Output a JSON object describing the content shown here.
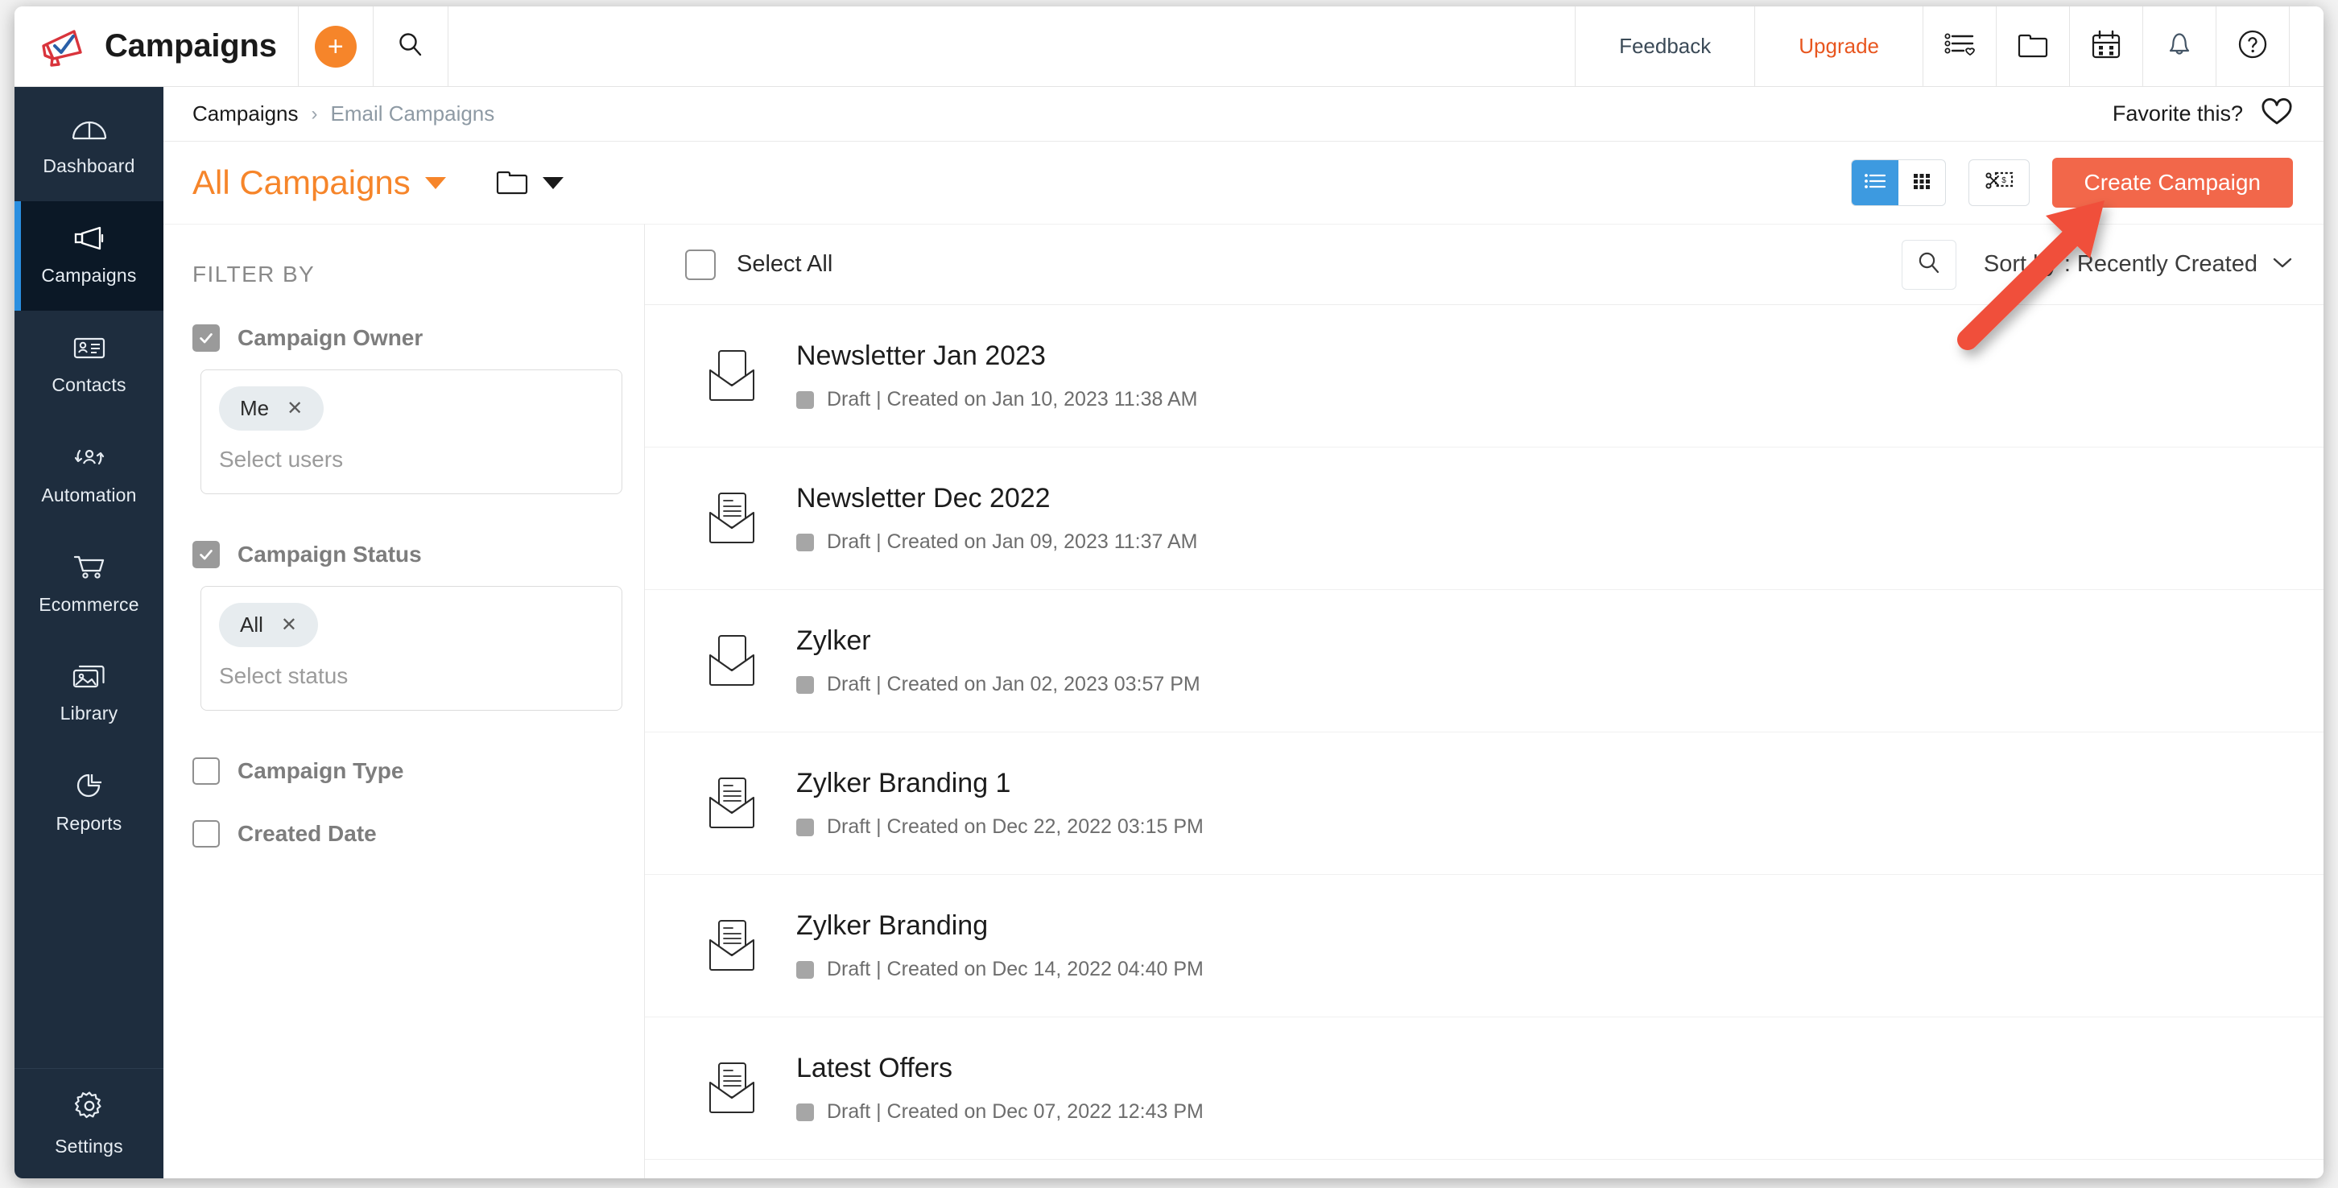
{
  "header": {
    "logo_icon": "megaphone-check-logo",
    "app_title": "Campaigns",
    "add_icon": "plus-icon",
    "search_icon": "search-icon",
    "feedback_label": "Feedback",
    "upgrade_label": "Upgrade",
    "icons": [
      {
        "name": "checklist-heart-icon"
      },
      {
        "name": "folder-icon"
      },
      {
        "name": "calendar-icon"
      },
      {
        "name": "bell-icon"
      },
      {
        "name": "help-icon"
      }
    ],
    "accent_orange": "#f6852a",
    "upgrade_color": "#e8561f"
  },
  "sidebar": {
    "background": "#1e2d3e",
    "active_background": "#0b1826",
    "active_marker": "#2a8fe0",
    "items": [
      {
        "label": "Dashboard",
        "icon": "dashboard-gauge-icon",
        "active": false
      },
      {
        "label": "Campaigns",
        "icon": "megaphone-icon",
        "active": true
      },
      {
        "label": "Contacts",
        "icon": "contact-card-icon",
        "active": false
      },
      {
        "label": "Automation",
        "icon": "automation-user-cycle-icon",
        "active": false
      },
      {
        "label": "Ecommerce",
        "icon": "shopping-cart-icon",
        "active": false
      },
      {
        "label": "Library",
        "icon": "image-library-icon",
        "active": false
      },
      {
        "label": "Reports",
        "icon": "pie-chart-icon",
        "active": false
      }
    ],
    "bottom": {
      "label": "Settings",
      "icon": "gear-icon"
    }
  },
  "breadcrumb": {
    "parent": "Campaigns",
    "separator": "›",
    "current": "Email Campaigns",
    "favorite_label": "Favorite this?",
    "favorite_icon": "heart-outline-icon"
  },
  "toolbar": {
    "view_title": "All Campaigns",
    "view_caret_icon": "caret-down-icon",
    "folder_icon": "folder-icon",
    "folder_caret_icon": "caret-down-icon",
    "view_list_icon": "list-view-icon",
    "view_grid_icon": "grid-view-icon",
    "coupon_icon": "coupon-scissors-icon",
    "create_label": "Create Campaign",
    "create_color": "#f2674a",
    "active_view": "list"
  },
  "filters": {
    "heading": "FILTER BY",
    "groups": [
      {
        "label": "Campaign Owner",
        "checked": true,
        "chips": [
          {
            "label": "Me",
            "remove_icon": "close-icon"
          }
        ],
        "placeholder": "Select users"
      },
      {
        "label": "Campaign Status",
        "checked": true,
        "chips": [
          {
            "label": "All",
            "remove_icon": "close-icon"
          }
        ],
        "placeholder": "Select status"
      },
      {
        "label": "Campaign Type",
        "checked": false
      },
      {
        "label": "Created Date",
        "checked": false
      }
    ]
  },
  "list": {
    "select_all_label": "Select All",
    "select_all_checked": false,
    "search_icon": "search-icon",
    "sort_label": "Sort by : Recently Created",
    "sort_caret_icon": "chevron-down-icon",
    "status_color": "#a6a6a6",
    "rows": [
      {
        "title": "Newsletter Jan 2023",
        "status": "Draft",
        "meta": "Draft | Created on Jan 10, 2023 11:38 AM",
        "icon": "envelope-blank-icon"
      },
      {
        "title": "Newsletter Dec 2022",
        "status": "Draft",
        "meta": "Draft | Created on Jan 09, 2023 11:37 AM",
        "icon": "envelope-document-icon"
      },
      {
        "title": "Zylker",
        "status": "Draft",
        "meta": "Draft | Created on Jan 02, 2023 03:57 PM",
        "icon": "envelope-blank-icon"
      },
      {
        "title": "Zylker Branding 1",
        "status": "Draft",
        "meta": "Draft | Created on Dec 22, 2022 03:15 PM",
        "icon": "envelope-document-icon"
      },
      {
        "title": "Zylker Branding",
        "status": "Draft",
        "meta": "Draft | Created on Dec 14, 2022 04:40 PM",
        "icon": "envelope-document-icon"
      },
      {
        "title": "Latest Offers",
        "status": "Draft",
        "meta": "Draft | Created on Dec 07, 2022 12:43 PM",
        "icon": "envelope-document-icon"
      }
    ]
  },
  "annotation": {
    "arrow_color": "#f0503a",
    "points_to": "create-campaign-button"
  }
}
